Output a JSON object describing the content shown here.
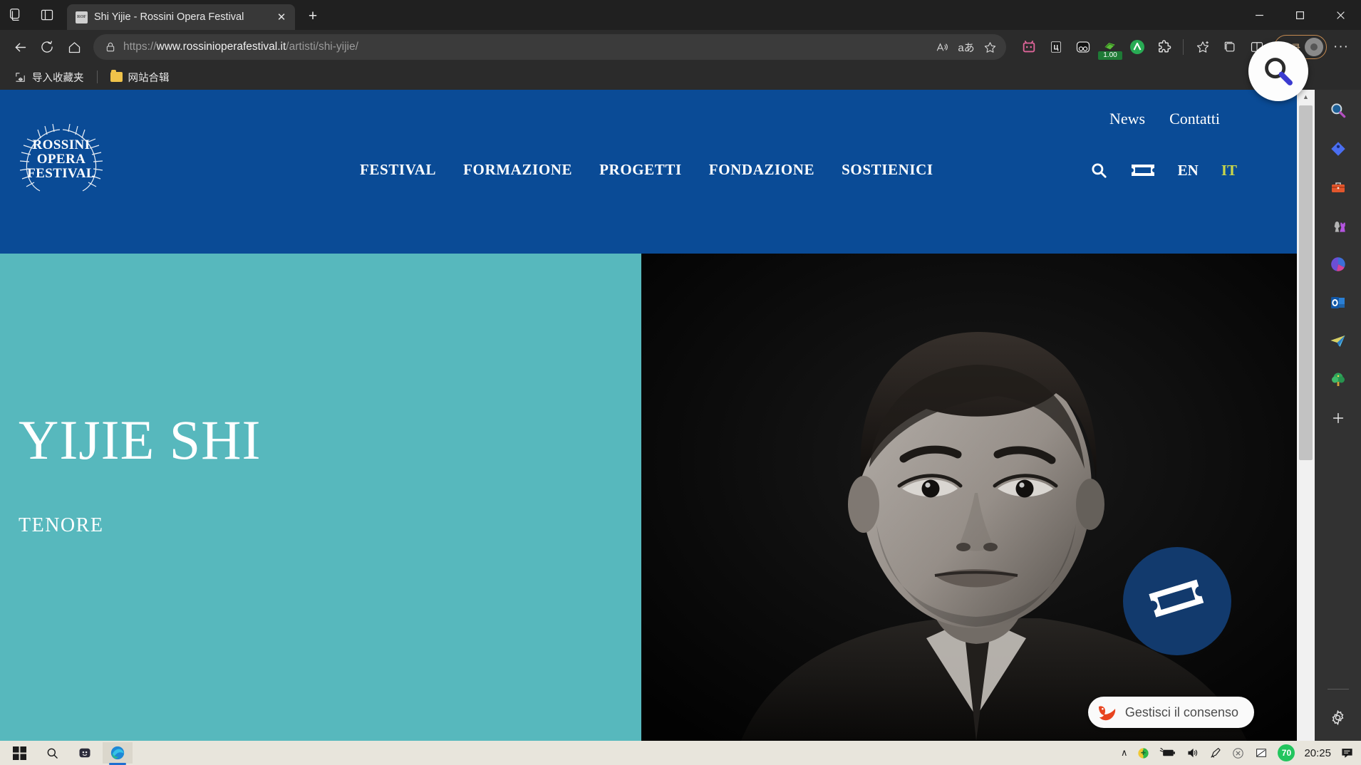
{
  "browser": {
    "tab": {
      "title": "Shi Yijie - Rossini Opera Festival",
      "favicon_text": "ROF",
      "close_label": "✕"
    },
    "newtab_label": "+",
    "window_controls": {
      "minimize": "—",
      "maximize": "☐",
      "close": "✕"
    },
    "omnibox": {
      "url_prefix": "https://",
      "url_domain": "www.rossinioperafestival.it",
      "url_path": "/artisti/shi-yijie/",
      "lock_icon": "lock-icon",
      "read_aloud_icon": "read-aloud-icon",
      "translate_label": "aあ",
      "favorite_icon": "star-icon"
    },
    "extensions": [
      {
        "name": "pink-extension-icon",
        "label": "",
        "badge": ""
      },
      {
        "name": "li-extension-icon",
        "label": "L",
        "badge": ""
      },
      {
        "name": "goggles-extension-icon",
        "label": "",
        "badge": ""
      },
      {
        "name": "coupon-extension-icon",
        "label": "",
        "badge": "1.00"
      },
      {
        "name": "green-a-extension-icon",
        "label": "Λ",
        "badge": ""
      },
      {
        "name": "puzzle-extensions-icon",
        "label": "",
        "badge": ""
      }
    ],
    "collections_icon": "collections-icon",
    "split_screen_icon": "split-screen-icon",
    "profile": {
      "text": "登录",
      "avatar": "avatar"
    },
    "settings_more_label": "···",
    "bookmarks": [
      {
        "label": "导入收藏夹",
        "icon": "import-favorites-icon"
      },
      {
        "label": "网站合辑",
        "icon": "folder-icon"
      }
    ]
  },
  "site": {
    "logo": {
      "line1": "ROSSINI",
      "line2": "OPERA",
      "line3": "FESTIVAL"
    },
    "top_nav": [
      {
        "label": "News"
      },
      {
        "label": "Contatti"
      }
    ],
    "main_nav": [
      {
        "label": "FESTIVAL"
      },
      {
        "label": "FORMAZIONE"
      },
      {
        "label": "PROGETTI"
      },
      {
        "label": "FONDAZIONE"
      },
      {
        "label": "SOSTIENICI"
      }
    ],
    "nav_tools": {
      "search_icon": "search-icon",
      "ticket_icon": "ticket-icon",
      "lang_en": "EN",
      "lang_it": "IT"
    },
    "hero": {
      "title": "YIJIE SHI",
      "subtitle": "TENORE",
      "background_color": "#57b8bd",
      "ticket_fab_icon": "ticket-icon"
    },
    "consent": {
      "label": "Gestisci il consenso",
      "icon": "fox-icon"
    }
  },
  "edge_sidebar": [
    {
      "name": "sidebar-search-icon"
    },
    {
      "name": "sidebar-shopping-icon"
    },
    {
      "name": "sidebar-tools-icon"
    },
    {
      "name": "sidebar-games-icon"
    },
    {
      "name": "sidebar-office-icon"
    },
    {
      "name": "sidebar-outlook-icon"
    },
    {
      "name": "sidebar-telegram-icon"
    },
    {
      "name": "sidebar-tree-icon"
    },
    {
      "name": "sidebar-add-icon"
    },
    {
      "name": "sidebar-settings-icon"
    }
  ],
  "taskbar": {
    "start_icon": "windows-start-icon",
    "search_icon": "taskbar-search-icon",
    "widgets_icon": "task-view-icon",
    "edge_icon": "edge-icon",
    "tray": {
      "chevron": "∧",
      "battery_percent": "70",
      "clock": "20:25"
    }
  },
  "overlay": {
    "magnifier_icon": "magnifier-cursor-icon"
  }
}
